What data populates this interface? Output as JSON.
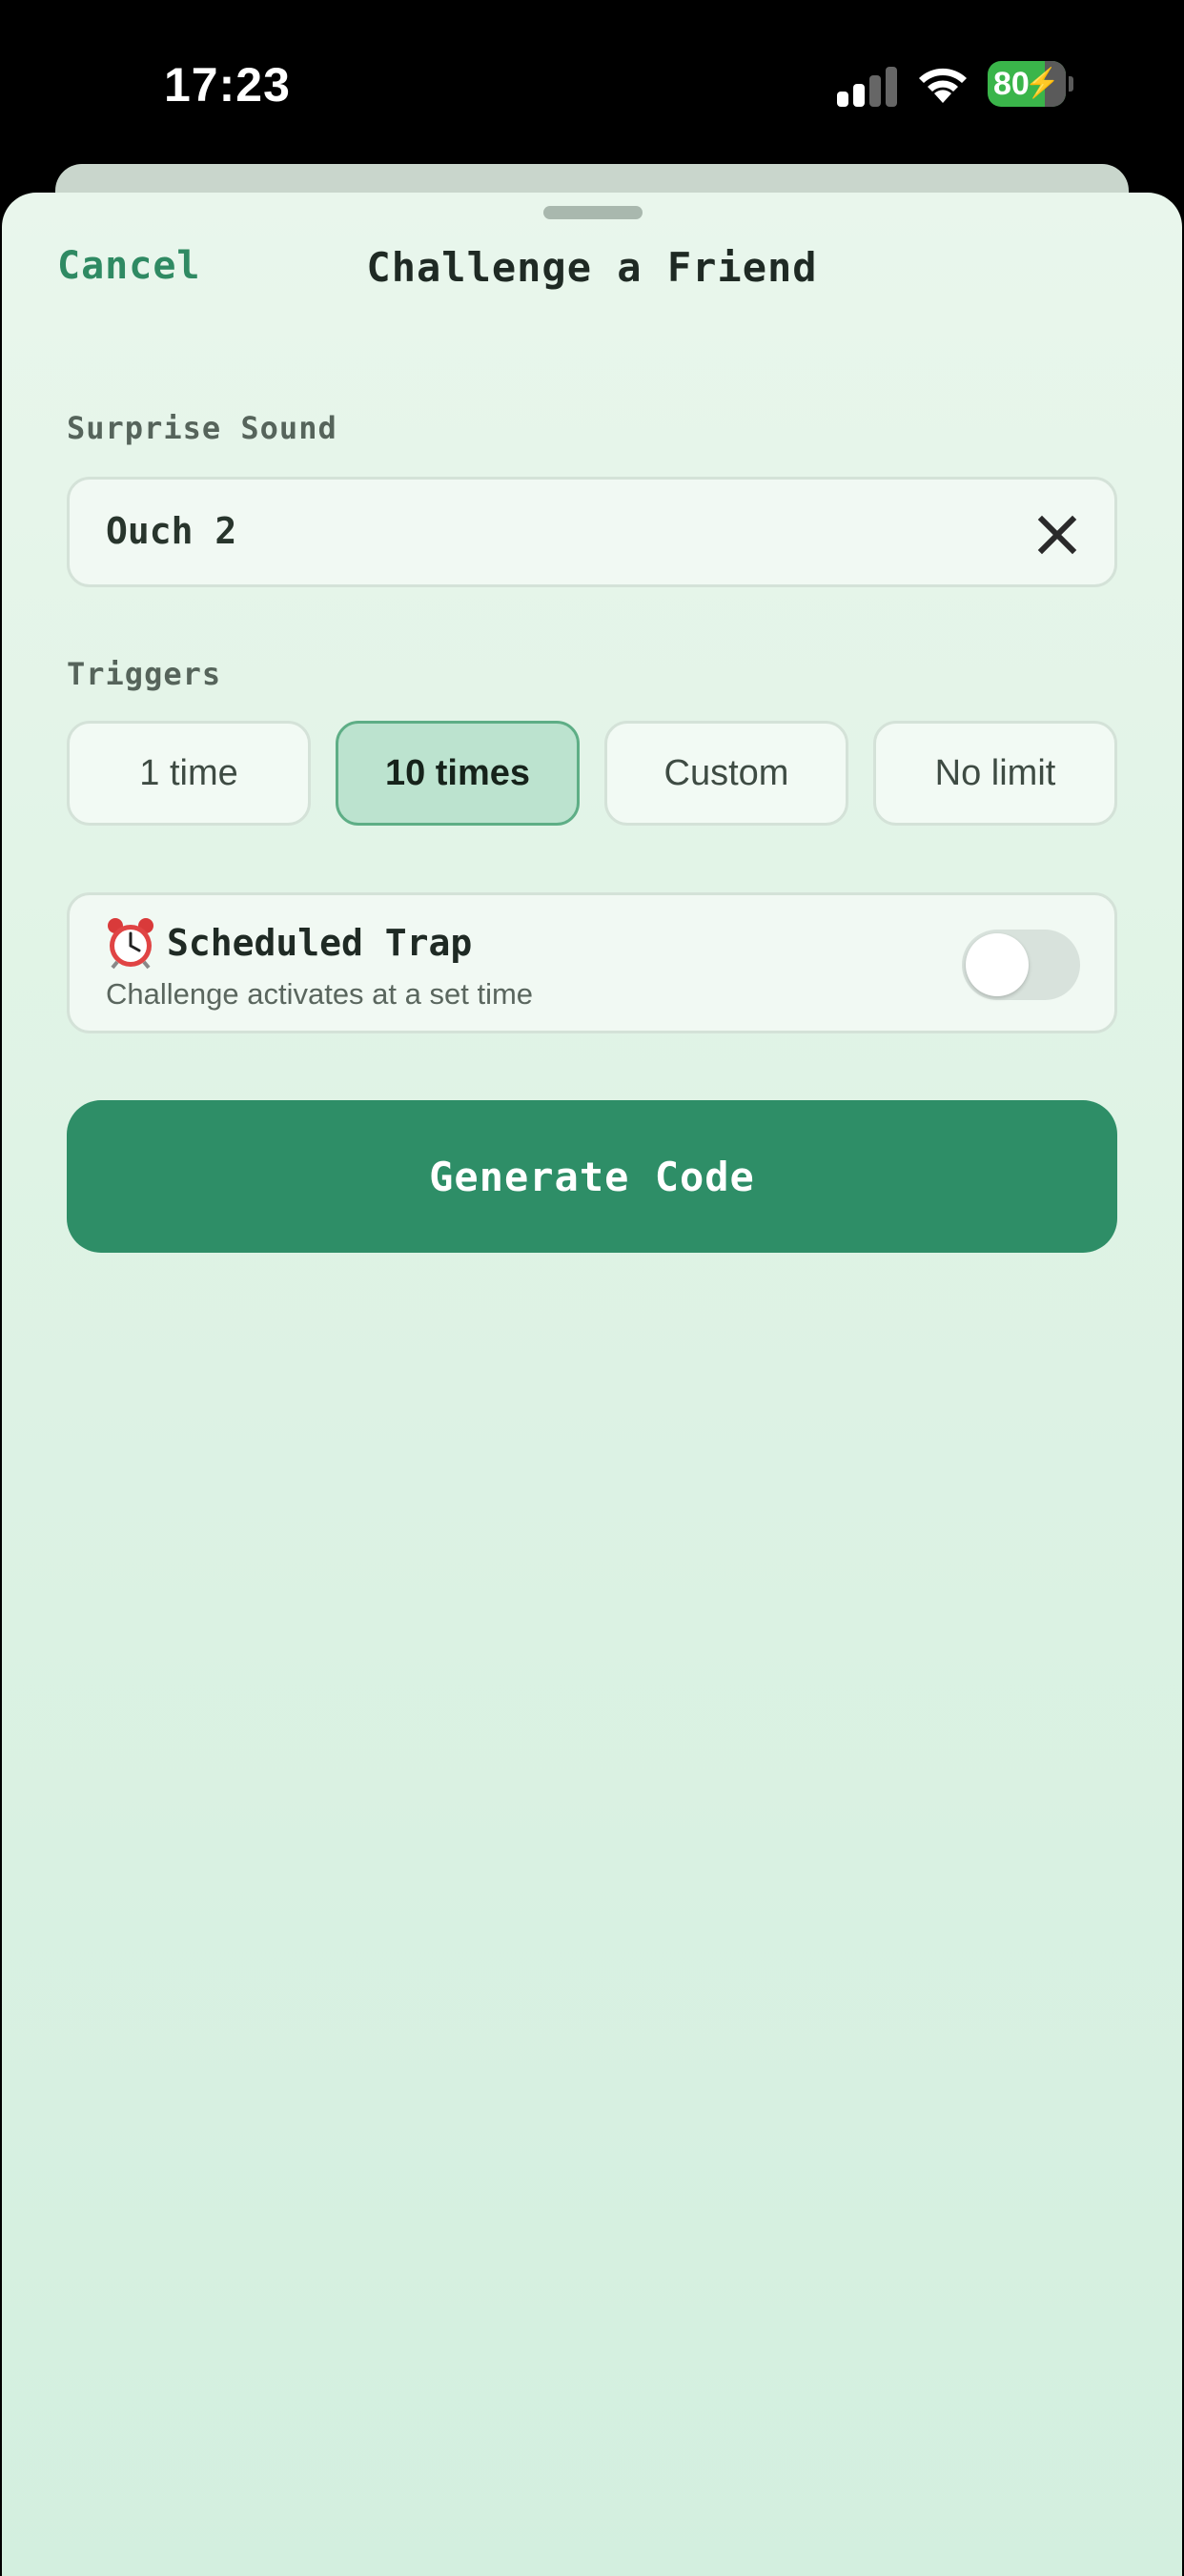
{
  "status_bar": {
    "time": "17:23",
    "battery": "80",
    "icons": [
      "signal-icon",
      "wifi-icon",
      "battery-charging-icon"
    ]
  },
  "header": {
    "cancel_label": "Cancel",
    "title": "Challenge a Friend"
  },
  "sound": {
    "label": "Surprise Sound",
    "value": "Ouch 2",
    "clear_icon": "close-icon"
  },
  "triggers": {
    "label": "Triggers",
    "options": [
      {
        "label": "1 time",
        "selected": false
      },
      {
        "label": "10 times",
        "selected": true
      },
      {
        "label": "Custom",
        "selected": false
      },
      {
        "label": "No limit",
        "selected": false
      }
    ]
  },
  "scheduled": {
    "icon": "alarm-clock-icon",
    "title": "Scheduled Trap",
    "subtitle": "Challenge activates at a set time",
    "enabled": false
  },
  "generate_label": "Generate Code",
  "colors": {
    "accent": "#2e8e67",
    "selected_bg": "#bce3cf",
    "sheet_bg": "#e9f6ec"
  }
}
